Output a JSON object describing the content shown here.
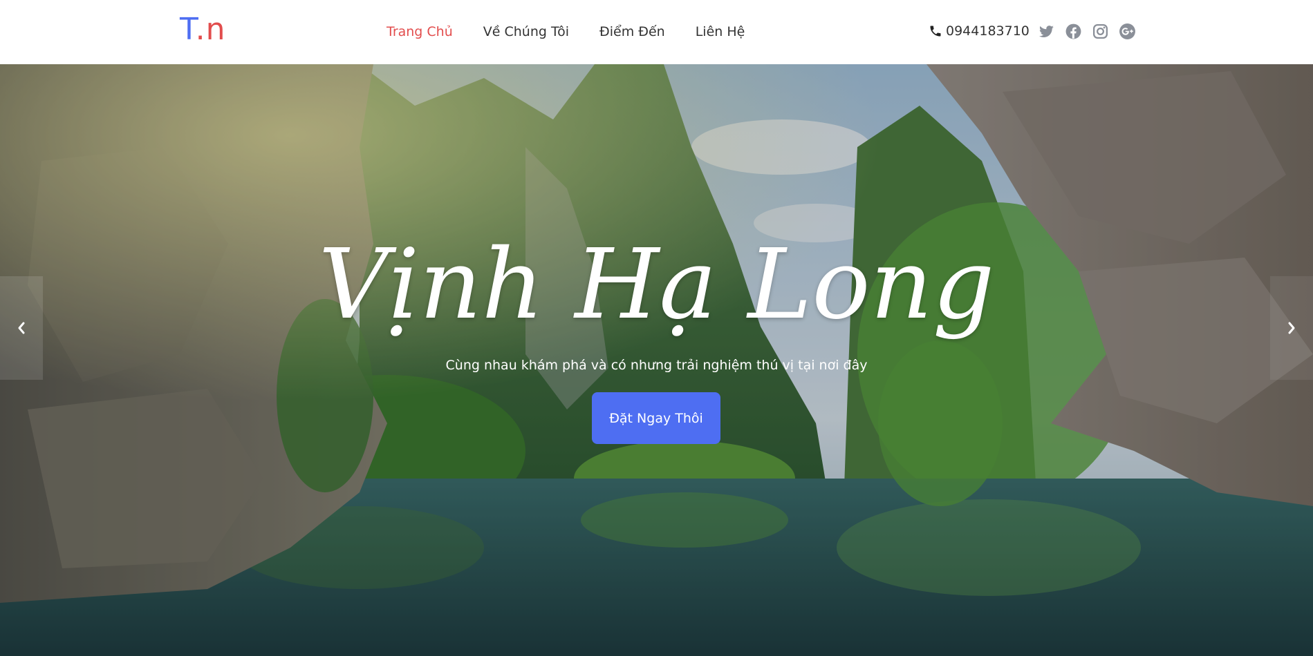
{
  "brand": {
    "logo_first": "T",
    "logo_dot": ".",
    "logo_last": "n",
    "colors": {
      "blue": "#4e6ef2",
      "red": "#e24d4d"
    }
  },
  "nav": {
    "items": [
      {
        "label": "Trang Chủ",
        "active": true
      },
      {
        "label": "Về Chúng Tôi",
        "active": false
      },
      {
        "label": "Điểm Đến",
        "active": false
      },
      {
        "label": "Liên Hệ",
        "active": false
      }
    ],
    "active_color": "#e24d4d"
  },
  "contact": {
    "phone_icon": "phone-icon",
    "phone": "0944183710",
    "social_icons": [
      "twitter-icon",
      "facebook-icon",
      "instagram-icon",
      "google-plus-icon"
    ]
  },
  "hero": {
    "title": "Vịnh Hạ Long",
    "subtitle": "Cùng nhau khám phá và có nhưng trải nghiệm thú vị tại nơi đây",
    "cta_label": "Đặt Ngay Thôi",
    "cta_color": "#4e6ef2",
    "prev_icon": "chevron-left-icon",
    "next_icon": "chevron-right-icon"
  }
}
